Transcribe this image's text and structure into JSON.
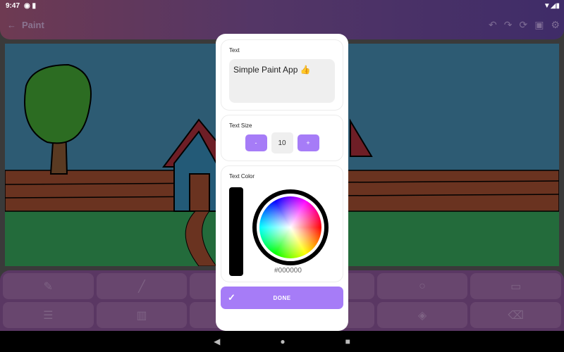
{
  "status": {
    "time": "9:47"
  },
  "appbar": {
    "title": "Paint",
    "back_icon": "arrow-left-icon",
    "actions": [
      "undo-icon",
      "redo-icon",
      "reset-icon",
      "save-icon",
      "gear-icon"
    ]
  },
  "dialog": {
    "text_label": "Text",
    "text_value": "Simple Paint App 👍",
    "size_label": "Text Size",
    "size_minus": "-",
    "size_value": "10",
    "size_plus": "+",
    "color_label": "Text Color",
    "color_hex": "#000000",
    "done_label": "DONE"
  },
  "tools": [
    "pen-icon",
    "line-icon",
    "",
    "",
    "circle-icon",
    "rectangle-icon",
    "horizontal-lines-icon",
    "vertical-lines-icon",
    "",
    "",
    "fill-icon",
    "eraser-icon"
  ]
}
